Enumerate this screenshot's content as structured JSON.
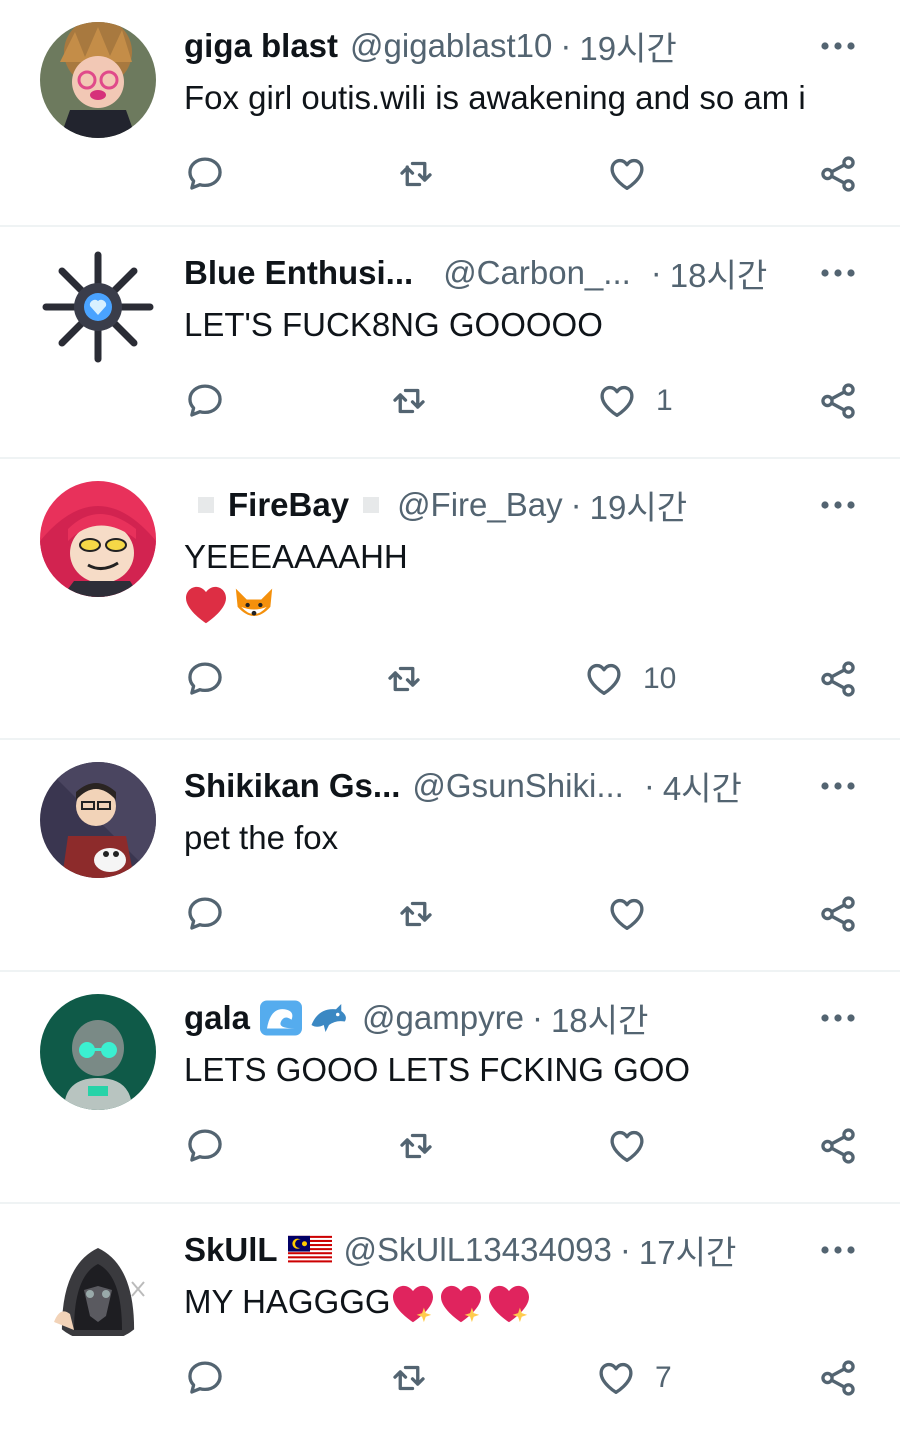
{
  "tweets": [
    {
      "name": "giga blast",
      "handle": "@gigablast10",
      "time": "19시간",
      "text": "Fox girl outis.wili is awakening and so am i",
      "likes": ""
    },
    {
      "name": "Blue Enthusi...",
      "handle": "@Carbon_...",
      "time": "18시간",
      "text": "LET'S FUCK8NG GOOOOO",
      "likes": "1"
    },
    {
      "name": "FireBay",
      "handle": "@Fire_Bay",
      "time": "19시간",
      "text": "YEEEAAAAHH",
      "likes": "10"
    },
    {
      "name": "Shikikan Gs...",
      "handle": "@GsunShiki...",
      "time": "4시간",
      "text": "pet the fox",
      "likes": ""
    },
    {
      "name": "gala",
      "handle": "@gampyre",
      "time": "18시간",
      "text": "LETS GOOO LETS FCKING GOO",
      "likes": ""
    },
    {
      "name": "SkUlL",
      "handle": "@SkUlL13434093",
      "time": "17시간",
      "text": "MY HAGGGG",
      "likes": "7"
    }
  ],
  "separator": "·",
  "icons": {
    "reply": "reply-icon",
    "retweet": "retweet-icon",
    "like": "heart-icon",
    "share": "share-icon",
    "more": "more-icon"
  },
  "colors": {
    "text": "#0f1419",
    "secondary": "#536471",
    "divider": "#eff3f4",
    "heart": "#e0245e"
  }
}
